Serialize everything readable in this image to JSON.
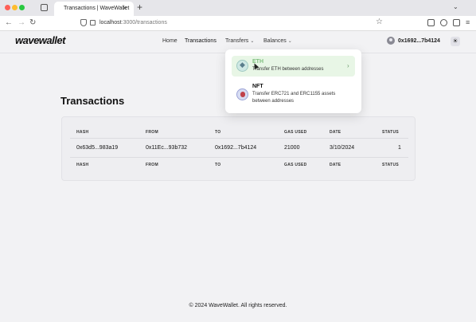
{
  "browser": {
    "tab_title": "Transactions | WaveWallet",
    "tab_close": "×",
    "new_tab": "+",
    "tab_list": "⌄",
    "url_host": "localhost",
    "url_path": ":3000/transactions"
  },
  "app": {
    "logo": "wavewallet",
    "nav": {
      "home": "Home",
      "transactions": "Transactions",
      "transfers": "Transfers",
      "balances": "Balances"
    },
    "address": "0x1692...7b4124",
    "theme_icon": "☀"
  },
  "dropdown": {
    "items": [
      {
        "title": "ETH",
        "description": "Transfer ETH between addresses",
        "icon": "eth-icon"
      },
      {
        "title": "NFT",
        "description": "Transfer ERC721 and ERC1155 assets between addresses",
        "icon": "nft-icon"
      }
    ]
  },
  "page": {
    "title": "Transactions"
  },
  "table": {
    "headers": [
      "HASH",
      "FROM",
      "TO",
      "GAS USED",
      "DATE",
      "STATUS"
    ],
    "rows": [
      [
        "0x63d5...983a19",
        "0x11Ec...93b732",
        "0x1692...7b4124",
        "21000",
        "3/10/2024",
        "1"
      ]
    ],
    "footer_headers": [
      "HASH",
      "FROM",
      "TO",
      "GAS USED",
      "DATE",
      "STATUS"
    ]
  },
  "footer": {
    "text": "© 2024 WaveWallet. All rights reserved."
  }
}
